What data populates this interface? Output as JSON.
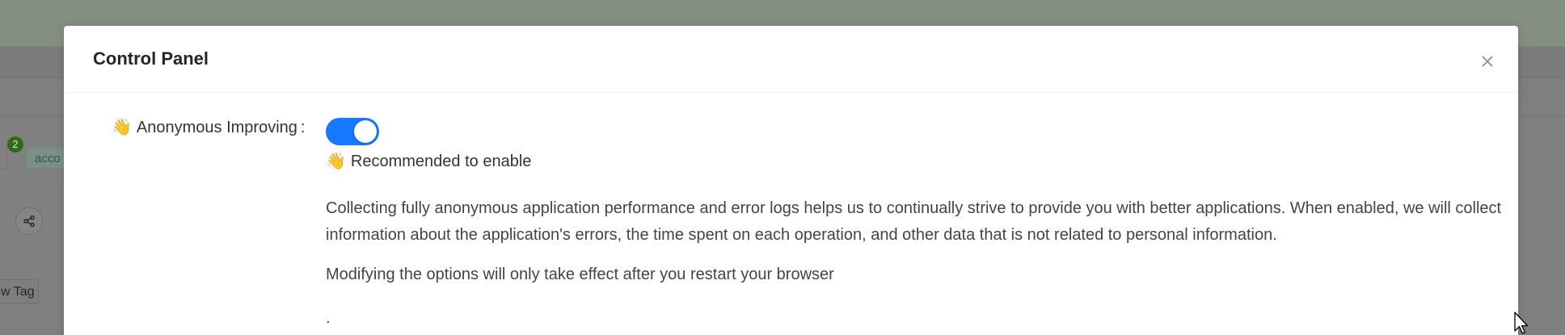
{
  "background": {
    "badge_count": "2",
    "tag_label": "acco",
    "new_tag_label": "w Tag"
  },
  "modal": {
    "title": "Control Panel",
    "close_icon": "close-icon",
    "setting": {
      "emoji": "👋",
      "label": "Anonymous Improving",
      "colon": ":",
      "toggle_state": "on",
      "recommend_emoji": "👋",
      "recommend_text": "Recommended to enable",
      "description": "Collecting fully anonymous application performance and error logs helps us to continually strive to provide you with better applications. When enabled, we will collect information about the application's errors, the time spent on each operation, and other data that is not related to personal information.",
      "restart_note": "Modifying the options will only take effect after you restart your browser",
      "trailing_text": "."
    }
  },
  "colors": {
    "toggle_on": "#1677ff",
    "overlay": "#808080"
  }
}
